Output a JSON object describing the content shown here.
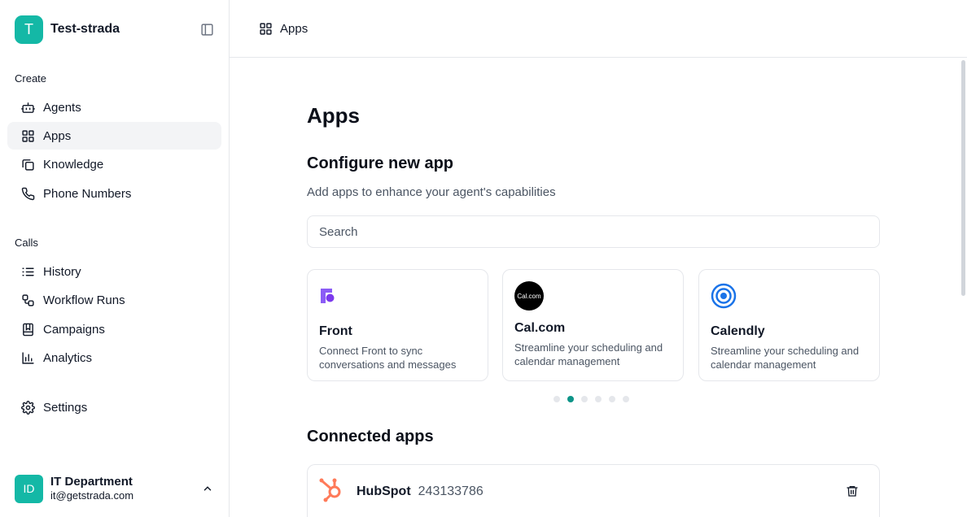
{
  "workspace": {
    "avatar_letter": "T",
    "name": "Test-strada"
  },
  "sidebar": {
    "sections": [
      {
        "label": "Create"
      },
      {
        "label": "Calls"
      }
    ],
    "items": [
      {
        "label": "Agents",
        "icon": "bot-icon"
      },
      {
        "label": "Apps",
        "icon": "grid-icon",
        "active": true
      },
      {
        "label": "Knowledge",
        "icon": "copy-icon"
      },
      {
        "label": "Phone Numbers",
        "icon": "phone-icon"
      },
      {
        "label": "History",
        "icon": "list-icon"
      },
      {
        "label": "Workflow Runs",
        "icon": "workflow-icon"
      },
      {
        "label": "Campaigns",
        "icon": "book-icon"
      },
      {
        "label": "Analytics",
        "icon": "bar-chart-icon"
      },
      {
        "label": "Settings",
        "icon": "gear-icon"
      }
    ]
  },
  "user": {
    "initials": "ID",
    "name": "IT Department",
    "email": "it@getstrada.com"
  },
  "topbar": {
    "title": "Apps"
  },
  "main": {
    "page_title": "Apps",
    "configure_title": "Configure new app",
    "configure_subtitle": "Add apps to enhance your agent's capabilities",
    "search_placeholder": "Search",
    "cards": [
      {
        "name": "Front",
        "description": "Connect Front to sync conversations and messages",
        "logo": "front-logo-icon",
        "logo_color": "#8b5cf6"
      },
      {
        "name": "Cal.com",
        "description": "Streamline your scheduling and calendar management",
        "logo": "calcom-logo-icon",
        "logo_text": "Cal.com",
        "logo_color": "#000000"
      },
      {
        "name": "Calendly",
        "description": "Streamline your scheduling and calendar management",
        "logo": "calendly-logo-icon",
        "logo_color": "#1a73e8"
      }
    ],
    "carousel": {
      "pages": 6,
      "active_index": 1
    },
    "connected_title": "Connected apps",
    "connected": [
      {
        "name": "HubSpot",
        "id": "243133786",
        "logo": "hubspot-logo-icon",
        "logo_color": "#ff7a59"
      }
    ]
  },
  "colors": {
    "accent": "#14b8a6",
    "active_dot": "#0d9488",
    "border": "#e5e7eb"
  }
}
